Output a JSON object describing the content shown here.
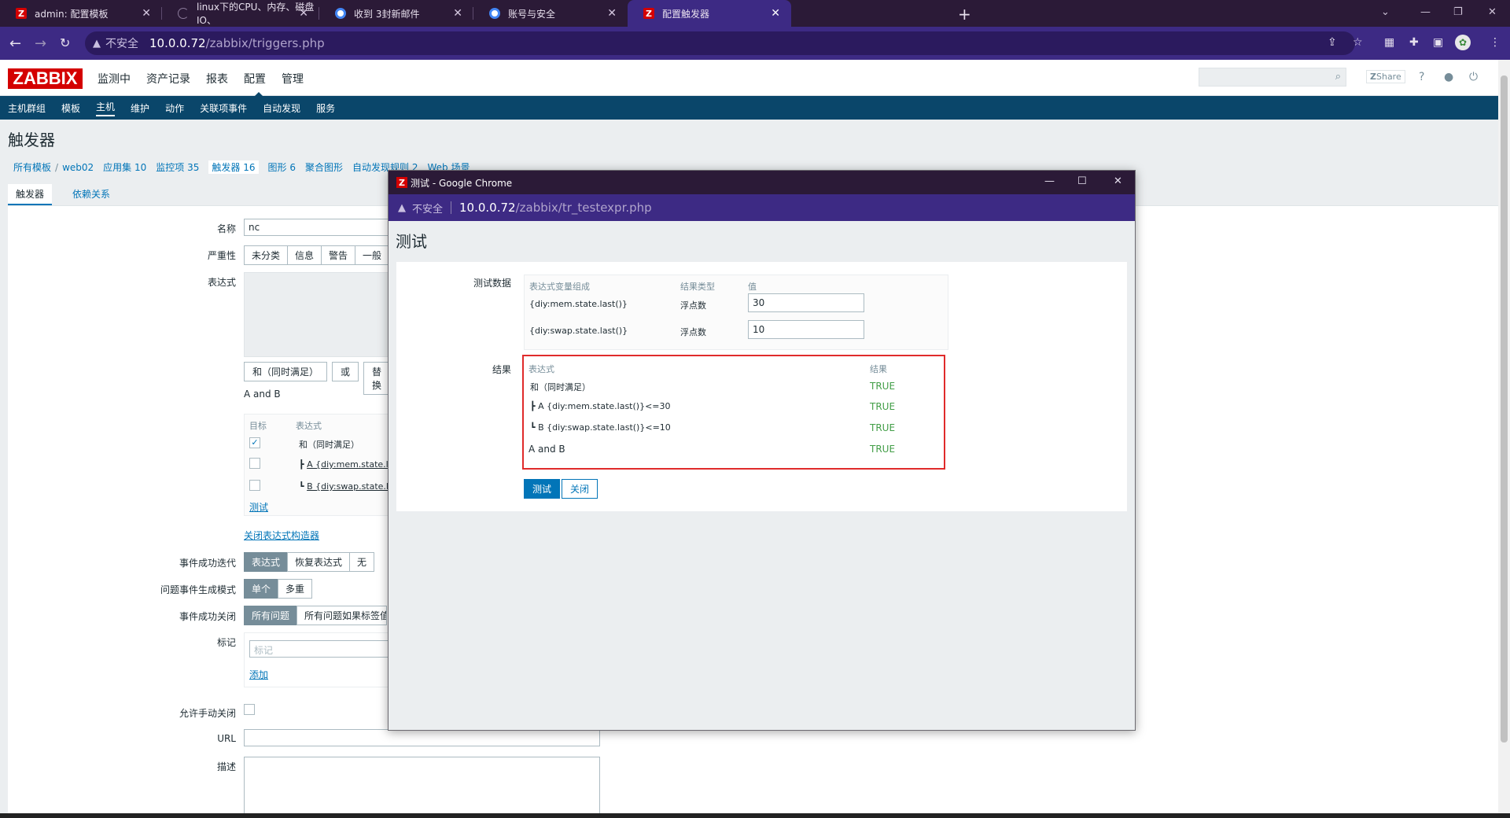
{
  "browser": {
    "tabs": [
      {
        "title": "admin: 配置模板",
        "icon": "zabbix-icon"
      },
      {
        "title": "linux下的CPU、内存、磁盘IO、",
        "icon": "loading-icon"
      },
      {
        "title": "收到 3封新邮件",
        "icon": "chrome-page-icon"
      },
      {
        "title": "账号与安全",
        "icon": "chrome-page-icon"
      },
      {
        "title": "配置触发器",
        "icon": "zabbix-icon"
      }
    ],
    "insecure_label": "不安全",
    "url_host": "10.0.0.72",
    "url_path": "/zabbix/triggers.php"
  },
  "zabbix": {
    "logo": "ZABBIX",
    "main_menu": [
      "监测中",
      "资产记录",
      "报表",
      "配置",
      "管理"
    ],
    "selected_main": "配置",
    "share_label": "Share",
    "sub_menu": [
      "主机群组",
      "模板",
      "主机",
      "维护",
      "动作",
      "关联项事件",
      "自动发现",
      "服务"
    ],
    "selected_sub": "主机",
    "page_title": "触发器",
    "breadcrumb": {
      "all_templates": "所有模板",
      "host": "web02",
      "apps": "应用集",
      "apps_count": "10",
      "items": "监控项",
      "items_count": "35",
      "triggers": "触发器",
      "triggers_count": "16",
      "graphs": "图形",
      "graphs_count": "6",
      "screens": "聚合图形",
      "discovery": "自动发现规则",
      "discovery_count": "2",
      "web": "Web 场景"
    },
    "form_tabs": [
      "触发器",
      "依赖关系"
    ],
    "form": {
      "name_label": "名称",
      "name_value": "nc",
      "severity_label": "严重性",
      "severity_options": [
        "未分类",
        "信息",
        "警告",
        "一般"
      ],
      "expression_label": "表达式",
      "btn_and": "和（同时满足）",
      "btn_or": "或",
      "btn_replace": "替换",
      "expr_summary": "A and B",
      "col_target": "目标",
      "col_expression": "表达式",
      "row_and": "和（同时满足）",
      "row_a": "A {diy:mem.state.la",
      "row_b": "B {diy:swap.state.la",
      "test_link": "测试",
      "close_builder": "关闭表达式构造器",
      "ok_event_gen_label": "事件成功迭代",
      "ok_event_gen": [
        "表达式",
        "恢复表达式",
        "无"
      ],
      "problem_mode_label": "问题事件生成模式",
      "problem_mode": [
        "单个",
        "多重"
      ],
      "ok_close_label": "事件成功关闭",
      "ok_close": [
        "所有问题",
        "所有问题如果标签值"
      ],
      "tags_label": "标记",
      "tags_placeholder": "标记",
      "tags_add": "添加",
      "manual_close_label": "允许手动关闭",
      "url_label": "URL",
      "desc_label": "描述"
    }
  },
  "popup": {
    "window_title": "测试 - Google Chrome",
    "insecure_label": "不安全",
    "url_host": "10.0.0.72",
    "url_path": "/zabbix/tr_testexpr.php",
    "heading": "测试",
    "test_data_label": "测试数据",
    "test_cols": [
      "表达式变量组成",
      "结果类型",
      "值"
    ],
    "test_rows": [
      {
        "expr": "{diy:mem.state.last()}",
        "type": "浮点数",
        "value": "30"
      },
      {
        "expr": "{diy:swap.state.last()}",
        "type": "浮点数",
        "value": "10"
      }
    ],
    "result_label": "结果",
    "result_cols": [
      "表达式",
      "结果"
    ],
    "result_rows": [
      {
        "expr": "和（同时满足）",
        "result": "TRUE"
      },
      {
        "expr": "A {diy:mem.state.last()}<=30",
        "result": "TRUE"
      },
      {
        "expr": "B {diy:swap.state.last()}<=10",
        "result": "TRUE"
      },
      {
        "expr": "A and B",
        "result": "TRUE"
      }
    ],
    "btn_test": "测试",
    "btn_close": "关闭"
  },
  "colors": {
    "accent": "#0275b8",
    "true_green": "#429e47",
    "highlight_red": "#e02b2b",
    "zabbix_red": "#d40000"
  }
}
